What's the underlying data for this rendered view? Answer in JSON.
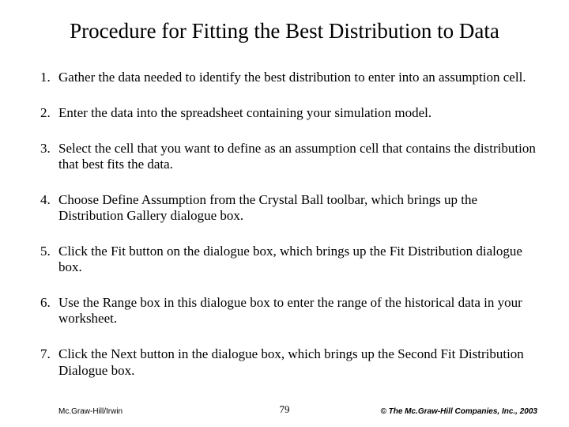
{
  "title": "Procedure for Fitting the Best Distribution to Data",
  "steps": [
    "Gather the data needed to identify the best distribution to enter into an assumption cell.",
    "Enter the data into the spreadsheet containing your simulation model.",
    "Select the cell that you want to define as an assumption cell that contains the distribution that best fits the data.",
    "Choose Define Assumption from the Crystal Ball toolbar, which brings up the Distribution Gallery dialogue box.",
    "Click the Fit button on the dialogue box, which brings up the Fit Distribution dialogue box.",
    "Use the Range box in this dialogue box to enter the range of the historical data in your worksheet.",
    "Click the Next button in the dialogue box, which brings up the Second Fit Distribution Dialogue box."
  ],
  "footer": {
    "left": "Mc.Graw-Hill/Irwin",
    "page": "79",
    "right": "© The Mc.Graw-Hill Companies, Inc., 2003"
  }
}
